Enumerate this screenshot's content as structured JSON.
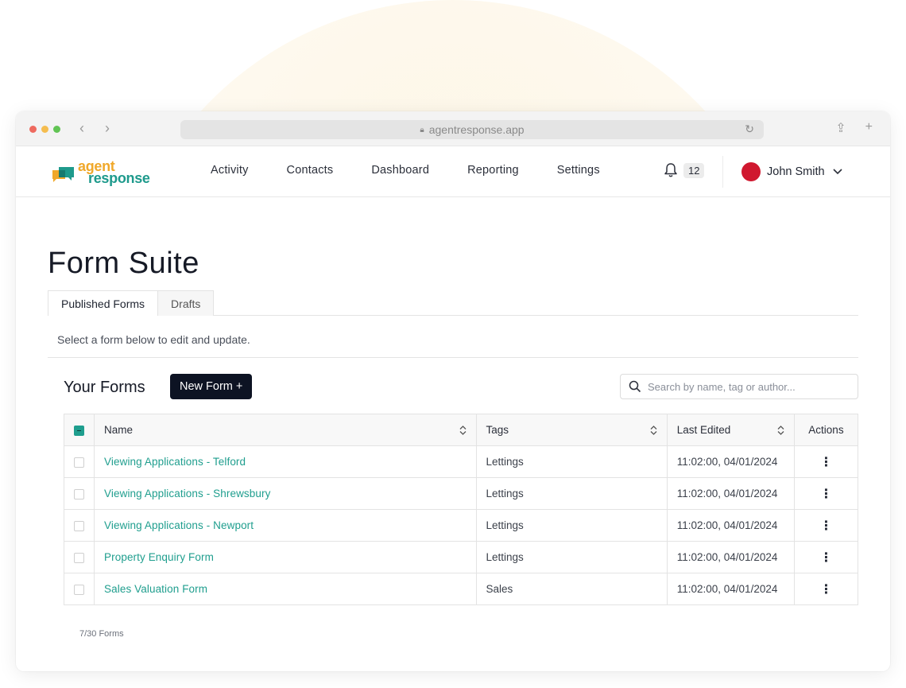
{
  "browser": {
    "url": "agentresponse.app"
  },
  "app": {
    "logo_line1": "agent",
    "logo_line2": "response",
    "nav": [
      "Activity",
      "Contacts",
      "Dashboard",
      "Reporting",
      "Settings"
    ],
    "notifications_count": "12",
    "user_name": "John Smith"
  },
  "page": {
    "title": "Form Suite",
    "tabs": [
      {
        "label": "Published Forms",
        "active": true
      },
      {
        "label": "Drafts",
        "active": false
      }
    ],
    "helper_text": "Select a form below to edit and update.",
    "forms_heading": "Your Forms",
    "new_form_label": "New Form +",
    "search_placeholder": "Search by name, tag or author..."
  },
  "table": {
    "columns": {
      "name": "Name",
      "tags": "Tags",
      "last_edited": "Last Edited",
      "actions": "Actions"
    },
    "rows": [
      {
        "name": "Viewing Applications - Telford",
        "tags": "Lettings",
        "last_edited": "11:02:00, 04/01/2024"
      },
      {
        "name": "Viewing Applications - Shrewsbury",
        "tags": "Lettings",
        "last_edited": "11:02:00, 04/01/2024"
      },
      {
        "name": "Viewing Applications - Newport",
        "tags": "Lettings",
        "last_edited": "11:02:00, 04/01/2024"
      },
      {
        "name": "Property Enquiry Form",
        "tags": "Lettings",
        "last_edited": "11:02:00, 04/01/2024"
      },
      {
        "name": "Sales Valuation Form",
        "tags": "Sales",
        "last_edited": "11:02:00, 04/01/2024"
      }
    ],
    "count_text": "7/30 Forms"
  },
  "colors": {
    "accent": "#1f9e8e",
    "logo_orange": "#f0a82a",
    "button_dark": "#0d1323"
  }
}
